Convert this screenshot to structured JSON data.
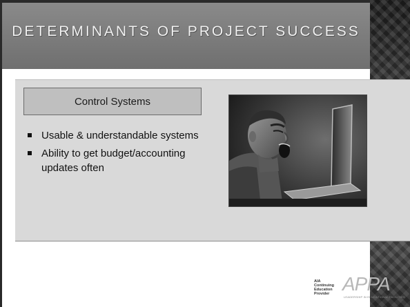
{
  "slide": {
    "title": "DETERMINANTS OF PROJECT SUCCESS",
    "box_heading": "Control Systems",
    "bullets": [
      "Usable & understandable systems",
      "Ability to get budget/accounting updates often"
    ]
  },
  "photo": {
    "icon": "screaming-man-at-laptop-photo"
  },
  "logos": {
    "aia": "AIA\nContinuing\nEducation\nProvider",
    "appa": "APPA",
    "appa_tagline": "LEADERSHIP IN EDUCATIONAL FACILITIES"
  },
  "colors": {
    "header_band": "#7a7a7a",
    "panel": "#d9d9d9",
    "box": "#bfbfbf",
    "right_strip": "#2e2e2e"
  }
}
